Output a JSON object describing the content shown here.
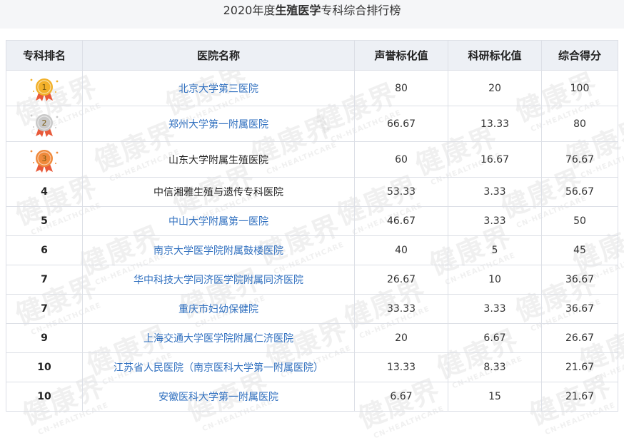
{
  "title": {
    "prefix": "2020年度",
    "bold": "生殖医学",
    "suffix": "专科综合排行榜"
  },
  "columns": [
    "专科排名",
    "医院名称",
    "声誉标化值",
    "科研标化值",
    "综合得分"
  ],
  "rows": [
    {
      "rank": "",
      "medal": "gold",
      "medal_num": "1",
      "name": "北京大学第三医院",
      "link": true,
      "reputation": "80",
      "research": "20",
      "score": "100"
    },
    {
      "rank": "",
      "medal": "silver",
      "medal_num": "2",
      "name": "郑州大学第一附属医院",
      "link": true,
      "reputation": "66.67",
      "research": "13.33",
      "score": "80"
    },
    {
      "rank": "",
      "medal": "bronze",
      "medal_num": "3",
      "name": "山东大学附属生殖医院",
      "link": false,
      "reputation": "60",
      "research": "16.67",
      "score": "76.67"
    },
    {
      "rank": "4",
      "name": "中信湘雅生殖与遗传专科医院",
      "link": false,
      "reputation": "53.33",
      "research": "3.33",
      "score": "56.67"
    },
    {
      "rank": "5",
      "name": "中山大学附属第一医院",
      "link": true,
      "reputation": "46.67",
      "research": "3.33",
      "score": "50"
    },
    {
      "rank": "6",
      "name": "南京大学医学院附属鼓楼医院",
      "link": true,
      "reputation": "40",
      "research": "5",
      "score": "45"
    },
    {
      "rank": "7",
      "name": "华中科技大学同济医学院附属同济医院",
      "link": true,
      "reputation": "26.67",
      "research": "10",
      "score": "36.67"
    },
    {
      "rank": "7",
      "name": "重庆市妇幼保健院",
      "link": true,
      "reputation": "33.33",
      "research": "3.33",
      "score": "36.67"
    },
    {
      "rank": "9",
      "name": "上海交通大学医学院附属仁济医院",
      "link": true,
      "reputation": "20",
      "research": "6.67",
      "score": "26.67"
    },
    {
      "rank": "10",
      "name": "江苏省人民医院（南京医科大学第一附属医院）",
      "link": true,
      "reputation": "13.33",
      "research": "8.33",
      "score": "21.67"
    },
    {
      "rank": "10",
      "name": "安徽医科大学第一附属医院",
      "link": true,
      "reputation": "6.67",
      "research": "15",
      "score": "21.67"
    }
  ],
  "watermark": {
    "cn": "健康界",
    "en": "CN-HEALTHCARE"
  },
  "colors": {
    "link": "#2f6fbf",
    "header_bg": "#edf0f5",
    "gold": "#f2b12a",
    "silver": "#c9c9c9",
    "bronze": "#f08a3c",
    "ribbon": "#e85a3a"
  }
}
